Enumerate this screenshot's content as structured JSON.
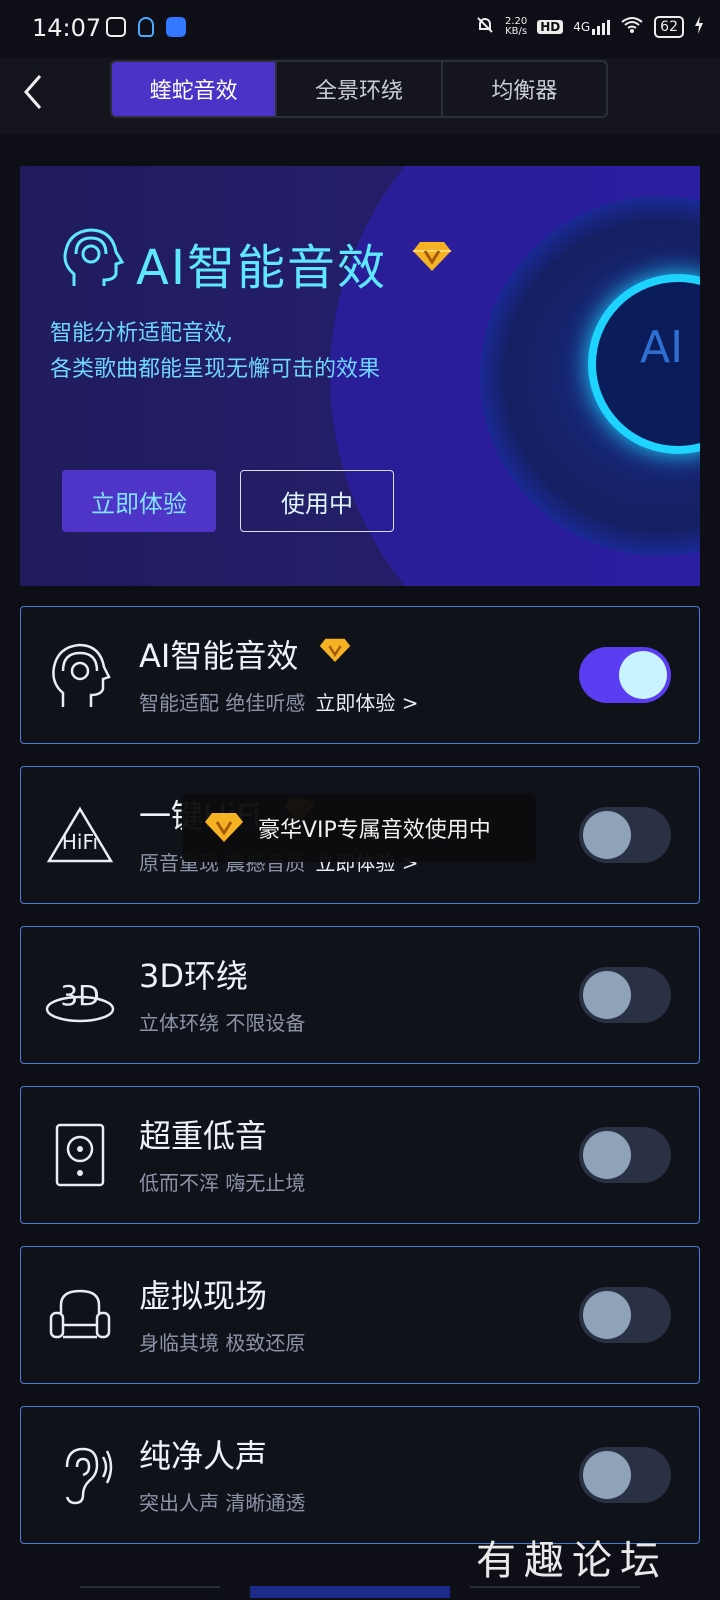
{
  "status_bar": {
    "time": "14:07",
    "net_speed_value": "2.20",
    "net_speed_unit": "KB/s",
    "network": "4G",
    "hd_label": "HD",
    "battery": "62"
  },
  "header": {
    "tabs": [
      {
        "label": "蝰蛇音效",
        "active": true
      },
      {
        "label": "全景环绕",
        "active": false
      },
      {
        "label": "均衡器",
        "active": false
      }
    ]
  },
  "banner": {
    "title": "AI智能音效",
    "desc_line1": "智能分析适配音效,",
    "desc_line2": "各类歌曲都能呈现无懈可击的效果",
    "core_label": "AI",
    "btn_try": "立即体验",
    "btn_using": "使用中"
  },
  "cards": [
    {
      "title": "AI智能音效",
      "subtitle": "智能适配 绝佳听感",
      "link": "立即体验 >",
      "vip": true,
      "enabled": true,
      "icon": "head-icon"
    },
    {
      "title": "一键HiFi",
      "subtitle": "原音重现 震撼音质",
      "link": "立即体验 >",
      "vip": true,
      "enabled": false,
      "icon": "hifi-icon",
      "icon_text": "HiFi"
    },
    {
      "title": "3D环绕",
      "subtitle": "立体环绕 不限设备",
      "enabled": false,
      "icon": "3d-icon",
      "icon_text": "3D"
    },
    {
      "title": "超重低音",
      "subtitle": "低而不浑 嗨无止境",
      "enabled": false,
      "icon": "speaker-icon"
    },
    {
      "title": "虚拟现场",
      "subtitle": "身临其境 极致还原",
      "enabled": false,
      "icon": "armchair-icon"
    },
    {
      "title": "纯净人声",
      "subtitle": "突出人声 清晰通透",
      "enabled": false,
      "icon": "ear-icon"
    }
  ],
  "toast": {
    "text": "豪华VIP专属音效使用中"
  },
  "watermark": {
    "text": "有趣论坛"
  },
  "colors": {
    "accent": "#4b33c8",
    "banner_text": "#5fe7ff",
    "card_border": "#4a7cd6",
    "toggle_on": "#5a3df0"
  }
}
